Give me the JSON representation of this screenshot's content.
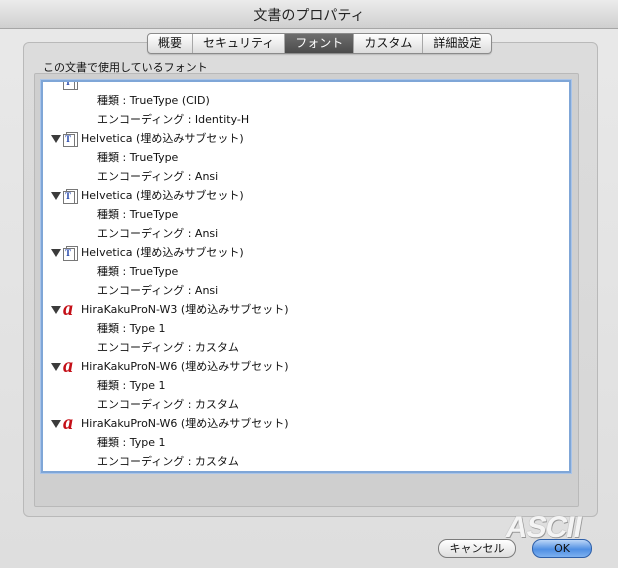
{
  "window": {
    "title": "文書のプロパティ"
  },
  "tabs": [
    {
      "label": "概要",
      "active": false
    },
    {
      "label": "セキュリティ",
      "active": false
    },
    {
      "label": "フォント",
      "active": true
    },
    {
      "label": "カスタム",
      "active": false
    },
    {
      "label": "詳細設定",
      "active": false
    }
  ],
  "section_label": "この文書で使用しているフォント",
  "fonts": [
    {
      "name": "",
      "icon": "truetype-icon",
      "expanded": true,
      "type": "種類 : TrueType (CID)",
      "encoding": "エンコーディング : Identity-H"
    },
    {
      "name": "Helvetica (埋め込みサブセット)",
      "icon": "truetype-icon",
      "expanded": true,
      "type": "種類 : TrueType",
      "encoding": "エンコーディング : Ansi"
    },
    {
      "name": "Helvetica (埋め込みサブセット)",
      "icon": "truetype-icon",
      "expanded": true,
      "type": "種類 : TrueType",
      "encoding": "エンコーディング : Ansi"
    },
    {
      "name": "Helvetica (埋め込みサブセット)",
      "icon": "truetype-icon",
      "expanded": true,
      "type": "種類 : TrueType",
      "encoding": "エンコーディング : Ansi"
    },
    {
      "name": "HiraKakuProN-W3 (埋め込みサブセット)",
      "icon": "type1-icon",
      "expanded": true,
      "type": "種類 : Type 1",
      "encoding": "エンコーディング : カスタム"
    },
    {
      "name": "HiraKakuProN-W6 (埋め込みサブセット)",
      "icon": "type1-icon",
      "expanded": true,
      "type": "種類 : Type 1",
      "encoding": "エンコーディング : カスタム"
    },
    {
      "name": "HiraKakuProN-W6 (埋め込みサブセット)",
      "icon": "type1-icon",
      "expanded": true,
      "type": "種類 : Type 1",
      "encoding": "エンコーディング : カスタム"
    }
  ],
  "buttons": {
    "cancel_label": "キャンセル",
    "ok_label": "OK"
  },
  "watermark": "ASCII",
  "colors": {
    "selected_tab": "#555555",
    "ok_button": "#4f8fe3",
    "list_focus_border": "#7fa6d7",
    "type1_icon": "#c40f17",
    "truetype_icon": "#1c3fa8"
  }
}
